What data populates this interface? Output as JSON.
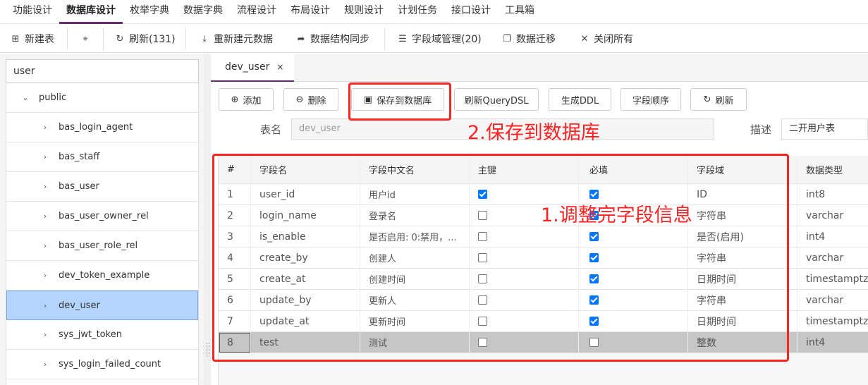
{
  "menu": [
    "功能设计",
    "数据库设计",
    "枚举字典",
    "数据字典",
    "流程设计",
    "布局设计",
    "规则设计",
    "计划任务",
    "接口设计",
    "工具箱"
  ],
  "toolbar": {
    "new_table": "新建表",
    "refresh": "刷新(131)",
    "rebuild_meta": "重新建元数据",
    "sync_structure": "数据结构同步",
    "domain_manage": "字段域管理(20)",
    "migrate": "数据迁移",
    "close_all": "关闭所有"
  },
  "search": {
    "value": "user"
  },
  "tree": {
    "schema": "public",
    "tables": [
      "bas_login_agent",
      "bas_staff",
      "bas_user",
      "bas_user_owner_rel",
      "bas_user_role_rel",
      "dev_token_example",
      "dev_user",
      "sys_jwt_token",
      "sys_login_failed_count"
    ],
    "selected_index": 6
  },
  "tab": {
    "label": "dev_user",
    "close": "×"
  },
  "actions": {
    "add": "添加",
    "delete": "删除",
    "save_db": "保存到数据库",
    "refresh_dsl": "刷新QueryDSL",
    "gen_ddl": "生成DDL",
    "field_order": "字段顺序",
    "refresh": "刷新"
  },
  "form": {
    "table_name_label": "表名",
    "table_name_value": "dev_user",
    "desc_label": "描述",
    "desc_value": "二开用户表"
  },
  "grid": {
    "headers": [
      "#",
      "字段名",
      "字段中文名",
      "主键",
      "必填",
      "字段域",
      "数据类型"
    ],
    "rows": [
      {
        "no": "1",
        "name": "user_id",
        "cn": "用户id",
        "pk": true,
        "req": true,
        "domain": "ID",
        "type": "int8"
      },
      {
        "no": "2",
        "name": "login_name",
        "cn": "登录名",
        "pk": false,
        "req": true,
        "domain": "字符串",
        "type": "varchar"
      },
      {
        "no": "3",
        "name": "is_enable",
        "cn": "是否启用: 0:禁用，...",
        "pk": false,
        "req": true,
        "domain": "是否(启用)",
        "type": "int4"
      },
      {
        "no": "4",
        "name": "create_by",
        "cn": "创建人",
        "pk": false,
        "req": true,
        "domain": "字符串",
        "type": "varchar"
      },
      {
        "no": "5",
        "name": "create_at",
        "cn": "创建时间",
        "pk": false,
        "req": true,
        "domain": "日期时间",
        "type": "timestamptz"
      },
      {
        "no": "6",
        "name": "update_by",
        "cn": "更新人",
        "pk": false,
        "req": true,
        "domain": "字符串",
        "type": "varchar"
      },
      {
        "no": "7",
        "name": "update_at",
        "cn": "更新时间",
        "pk": false,
        "req": true,
        "domain": "日期时间",
        "type": "timestamptz"
      },
      {
        "no": "8",
        "name": "test",
        "cn": "测试",
        "pk": false,
        "req": false,
        "domain": "整数",
        "type": "int4"
      }
    ],
    "selected_index": 7
  },
  "annotations": {
    "step1": "1.调整完字段信息",
    "step2": "2.保存到数据库",
    "color": "#ff2222"
  },
  "colors": {
    "accent": "#6a2c70",
    "selection": "#b3d4fc",
    "checkbox": "#0075ff"
  }
}
